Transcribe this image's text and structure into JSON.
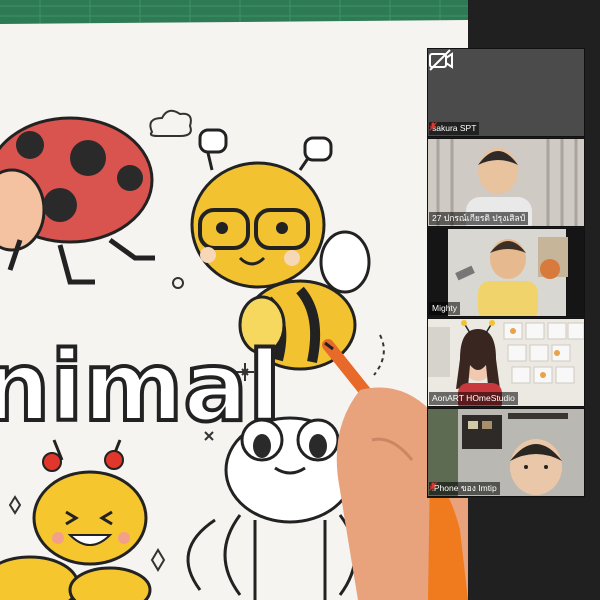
{
  "app": "video-meeting-gallery",
  "shared_video": {
    "drawing_word": "nimal",
    "subject": "animal coloring page"
  },
  "participants": [
    {
      "name": "sakura SPT",
      "muted": true,
      "video_on": false
    },
    {
      "name": "27 ปกรณ์เกียรติ ปรุงเสิลป์",
      "muted": false,
      "video_on": true
    },
    {
      "name": "Mighty",
      "muted": false,
      "video_on": true
    },
    {
      "name": "AonART HOmeStudio",
      "muted": false,
      "video_on": true
    },
    {
      "name": "iPhone ของ Imtip",
      "muted": true,
      "video_on": true
    }
  ],
  "icons": {
    "camera_off": "camera-off-icon",
    "mic_muted": "mic-muted-icon"
  },
  "colors": {
    "mic_muted": "#e0362c",
    "background": "#1f1f1f"
  }
}
